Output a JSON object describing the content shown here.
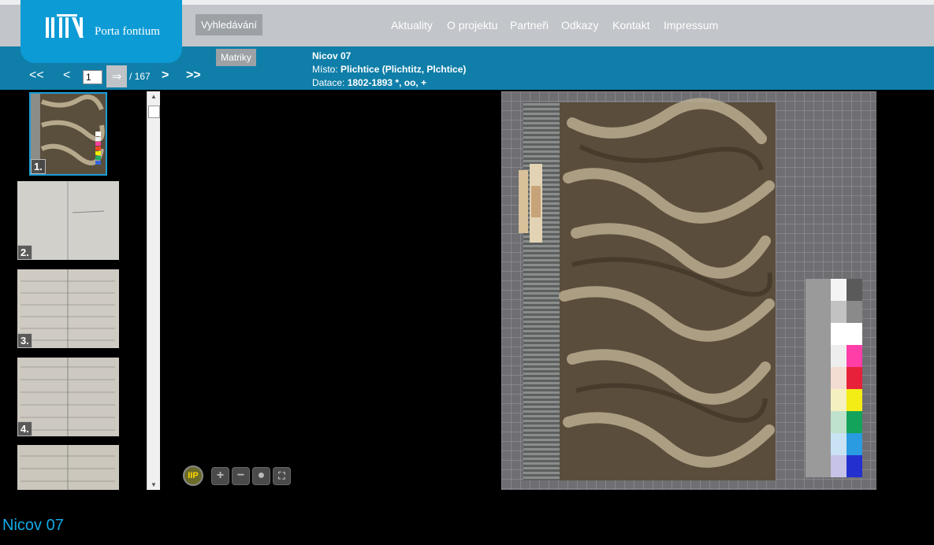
{
  "logo": {
    "text": "Porta fontium"
  },
  "header": {
    "search_label": "Vyhledávání",
    "nav": [
      "Aktuality",
      "O projektu",
      "Partneři",
      "Odkazy",
      "Kontakt",
      "Impressum"
    ]
  },
  "subbar": {
    "matriky_label": "Matriky",
    "pager": {
      "first": "<<",
      "prev": "<",
      "current_page": "1",
      "go": "⇒",
      "total": "/ 167",
      "next": ">",
      "last": ">>"
    },
    "info": {
      "title": "Nicov 07",
      "place_label": "Místo: ",
      "place_value": "Plichtice (Plichtitz, Plchtice)",
      "date_label": "Datace: ",
      "date_value": "1802-1893 *, oo, +"
    }
  },
  "thumbnails": [
    {
      "label": "1.",
      "selected": true
    },
    {
      "label": "2.",
      "selected": false
    },
    {
      "label": "3.",
      "selected": false
    },
    {
      "label": "4.",
      "selected": false
    },
    {
      "label": "",
      "selected": false
    }
  ],
  "viewer": {
    "iip_label": "IIP",
    "colors": {
      "accent": "#0d9bd5",
      "bar": "#0f7ea8",
      "title": "#12a9e6"
    }
  },
  "footer": {
    "title": "Nicov 07"
  }
}
